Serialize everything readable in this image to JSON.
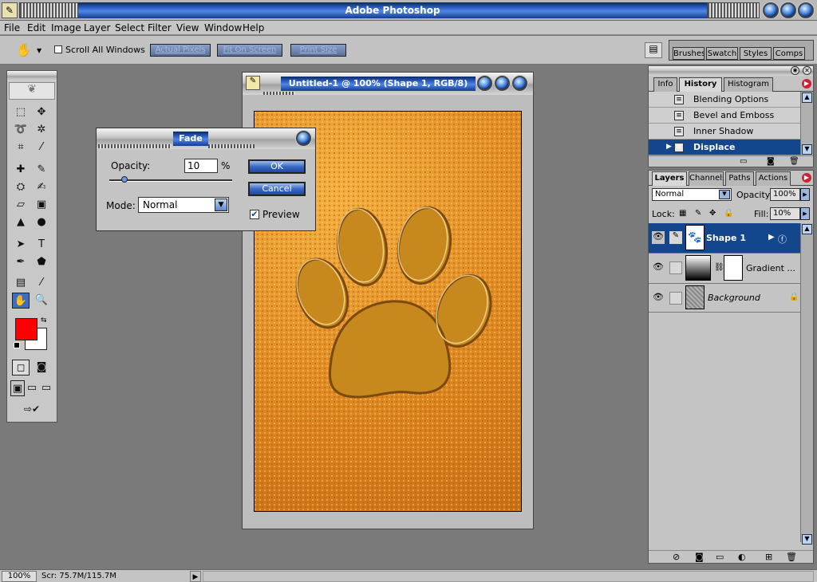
{
  "window": {
    "title": "Adobe Photoshop"
  },
  "menu": [
    "File",
    "Edit",
    "Image",
    "Layer",
    "Select",
    "Filter",
    "View",
    "Window",
    "Help"
  ],
  "options": {
    "scroll_all": "Scroll All Windows",
    "actual_pixels": "Actual Pixels",
    "fit_on_screen": "Fit On Screen",
    "print_size": "Print Size"
  },
  "well_tabs": [
    "Brushes",
    "Swatch",
    "Styles",
    "Comps"
  ],
  "document": {
    "title": "Untitled-1 @ 100% (Shape 1, RGB/8)"
  },
  "fade": {
    "title": "Fade",
    "opacity_label": "Opacity:",
    "opacity_value": "10",
    "percent": "%",
    "ok": "OK",
    "cancel": "Cancel",
    "mode_label": "Mode:",
    "mode_value": "Normal",
    "preview": "Preview",
    "opacity_fraction": 0.1
  },
  "history": {
    "tabs": [
      "Info",
      "History",
      "Histogram"
    ],
    "items": [
      "Blending Options",
      "Bevel and Emboss",
      "Inner Shadow",
      "Displace"
    ]
  },
  "layers": {
    "tabs": [
      "Layers",
      "Channels",
      "Paths",
      "Actions"
    ],
    "blend_mode": "Normal",
    "opacity_label": "Opacity:",
    "opacity_value": "100%",
    "lock_label": "Lock:",
    "fill_label": "Fill:",
    "fill_value": "10%",
    "items": [
      "Shape 1",
      "Gradient ...",
      "Background"
    ]
  },
  "status": {
    "zoom": "100%",
    "scratch": "Scr: 75.7M/115.7M"
  },
  "colors": {
    "foreground": "#ff0000",
    "background": "#ffffff",
    "accent": "#1a4a9a"
  }
}
